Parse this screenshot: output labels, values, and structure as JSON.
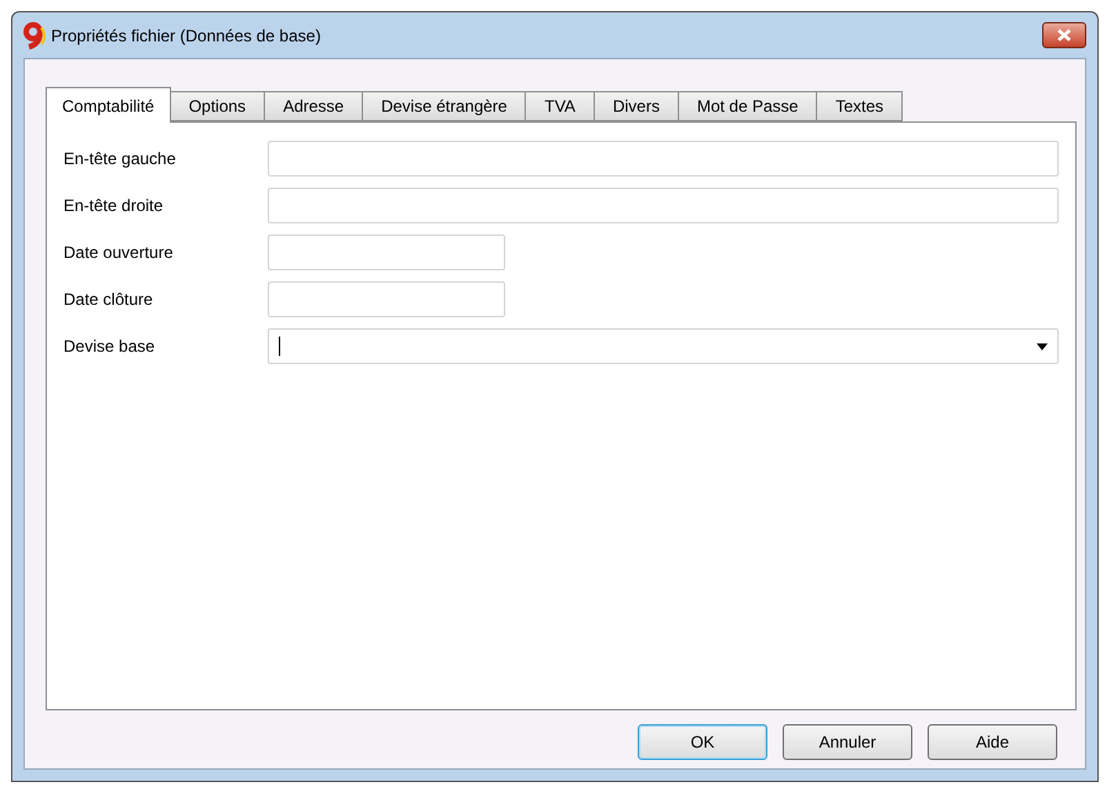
{
  "window": {
    "title": "Propriétés fichier (Données de base)"
  },
  "tabs": [
    {
      "label": "Comptabilité",
      "selected": true
    },
    {
      "label": "Options",
      "selected": false
    },
    {
      "label": "Adresse",
      "selected": false
    },
    {
      "label": "Devise étrangère",
      "selected": false
    },
    {
      "label": "TVA",
      "selected": false
    },
    {
      "label": "Divers",
      "selected": false
    },
    {
      "label": "Mot de Passe",
      "selected": false
    },
    {
      "label": "Textes",
      "selected": false
    }
  ],
  "fields": [
    {
      "label": "En-tête gauche",
      "kind": "wide",
      "focused": false
    },
    {
      "label": "En-tête droite",
      "kind": "wide",
      "focused": false
    },
    {
      "label": "Date ouverture",
      "kind": "short",
      "focused": false
    },
    {
      "label": "Date clôture",
      "kind": "short",
      "focused": false
    },
    {
      "label": "Devise base",
      "kind": "combo",
      "focused": true
    }
  ],
  "buttons": [
    {
      "label": "OK",
      "default": true
    },
    {
      "label": "Annuler",
      "default": false
    },
    {
      "label": "Aide",
      "default": false
    }
  ]
}
